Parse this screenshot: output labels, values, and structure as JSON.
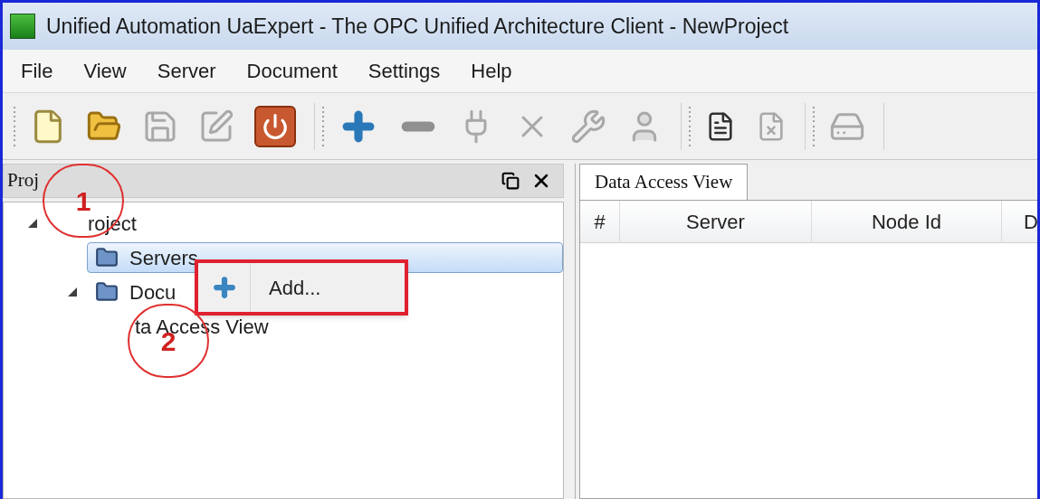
{
  "window": {
    "title": "Unified Automation UaExpert - The OPC Unified Architecture Client - NewProject"
  },
  "menu": [
    "File",
    "View",
    "Server",
    "Document",
    "Settings",
    "Help"
  ],
  "toolbar": [
    [
      {
        "kind": "new",
        "disabled": false
      },
      {
        "kind": "open",
        "disabled": false
      },
      {
        "kind": "save",
        "disabled": true
      },
      {
        "kind": "edit",
        "disabled": true
      },
      {
        "kind": "power",
        "disabled": false
      }
    ],
    [
      {
        "kind": "add",
        "disabled": false
      },
      {
        "kind": "remove",
        "disabled": false
      },
      {
        "kind": "connect",
        "disabled": true
      },
      {
        "kind": "disconnect",
        "disabled": true
      },
      {
        "kind": "wrench",
        "disabled": true
      },
      {
        "kind": "user",
        "disabled": true
      }
    ],
    [
      {
        "kind": "document",
        "disabled": false
      },
      {
        "kind": "delete-document",
        "disabled": true
      }
    ],
    [
      {
        "kind": "device",
        "disabled": true
      }
    ]
  ],
  "project_panel": {
    "title": "Proj",
    "tree": [
      {
        "label": "roject",
        "expanded": true,
        "selected": false,
        "children": [
          {
            "label": "Servers",
            "selected": true
          },
          {
            "label": "Docu",
            "expanded": true,
            "selected": false,
            "children": [
              {
                "label": "ta Access View",
                "selected": false
              }
            ]
          }
        ]
      }
    ]
  },
  "context_menu": {
    "items": [
      {
        "label": "Add..."
      }
    ]
  },
  "tabs": [
    {
      "label": "Data Access View",
      "selected": true
    }
  ],
  "table": {
    "columns": [
      "#",
      "Server",
      "Node Id",
      "D"
    ]
  },
  "annotations": [
    "1",
    "2"
  ]
}
